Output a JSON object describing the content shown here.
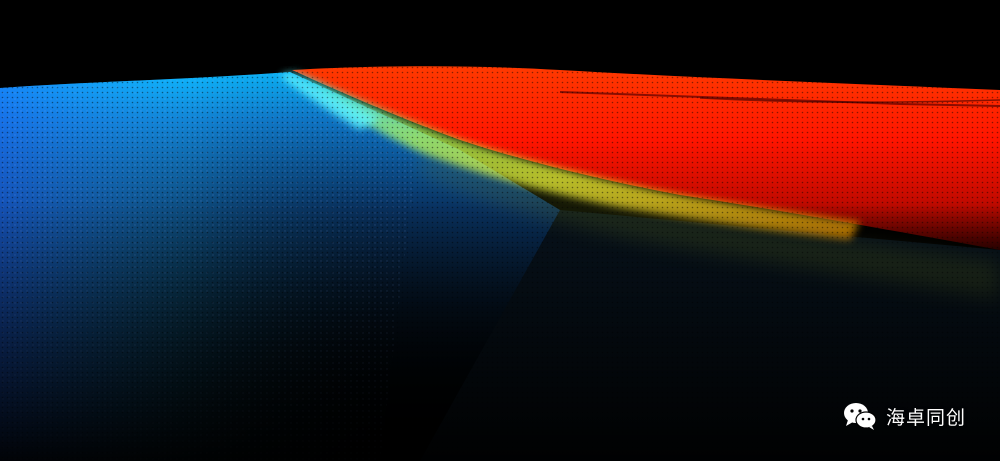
{
  "colors": {
    "background": "#000000",
    "deep": "#00bfff",
    "shelf_edge": "#f7ff3a",
    "shallow": "#ff1a00",
    "watermark_text": "#ffffff"
  },
  "watermark": {
    "icon": "wechat-icon",
    "text": "海卓同创"
  }
}
